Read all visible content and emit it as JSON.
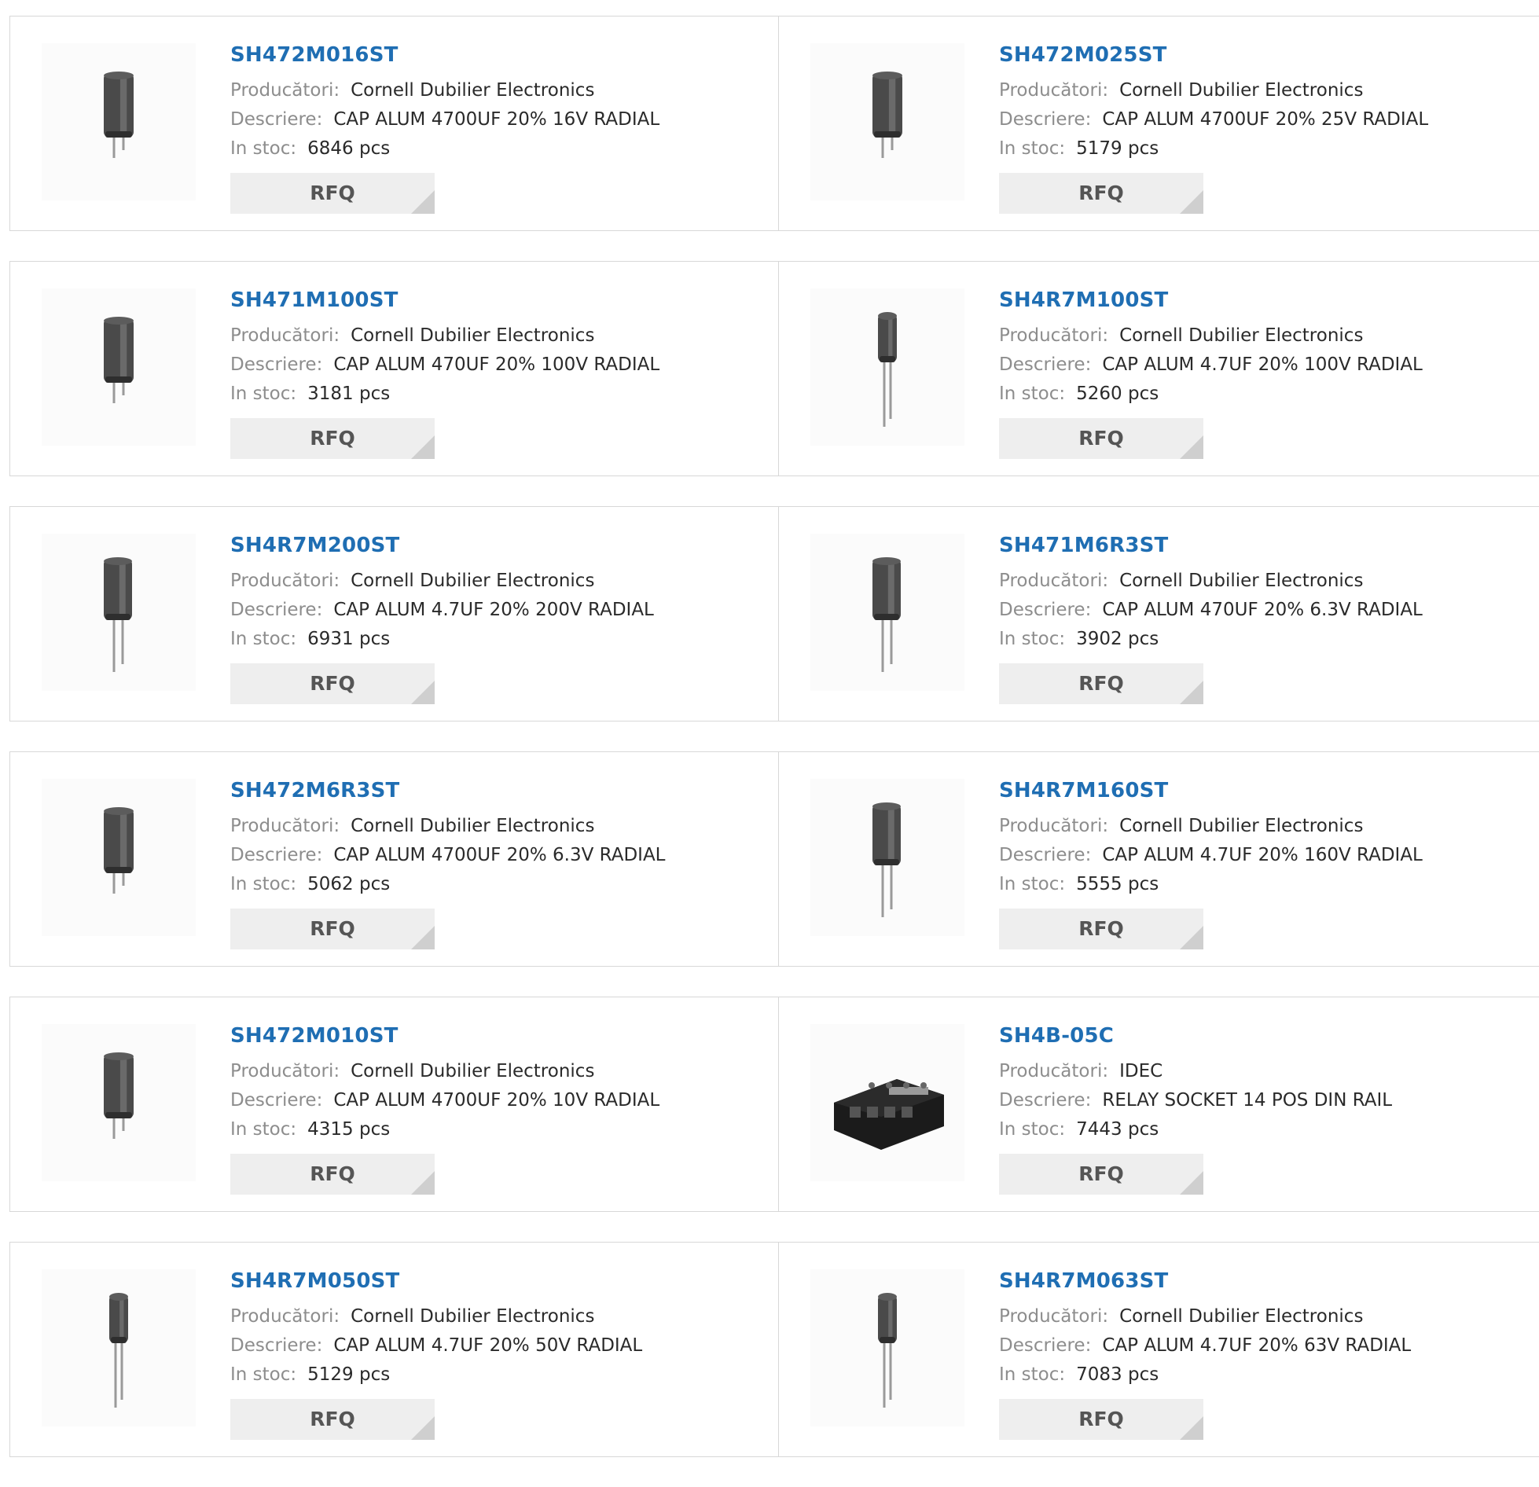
{
  "labels": {
    "manufacturer": "Producători:",
    "description": "Descriere:",
    "stock": "In stoc:",
    "rfq": "RFQ"
  },
  "products": [
    {
      "part": "SH472M016ST",
      "manufacturer": "Cornell Dubilier Electronics",
      "description": "CAP ALUM 4700UF 20% 16V RADIAL",
      "stock": "6846 pcs",
      "image": "capacitor-large-icon"
    },
    {
      "part": "SH472M025ST",
      "manufacturer": "Cornell Dubilier Electronics",
      "description": "CAP ALUM 4700UF 20% 25V RADIAL",
      "stock": "5179 pcs",
      "image": "capacitor-large-icon"
    },
    {
      "part": "SH471M100ST",
      "manufacturer": "Cornell Dubilier Electronics",
      "description": "CAP ALUM 470UF 20% 100V RADIAL",
      "stock": "3181 pcs",
      "image": "capacitor-large-icon"
    },
    {
      "part": "SH4R7M100ST",
      "manufacturer": "Cornell Dubilier Electronics",
      "description": "CAP ALUM 4.7UF 20% 100V RADIAL",
      "stock": "5260 pcs",
      "image": "capacitor-small-icon"
    },
    {
      "part": "SH4R7M200ST",
      "manufacturer": "Cornell Dubilier Electronics",
      "description": "CAP ALUM 4.7UF 20% 200V RADIAL",
      "stock": "6931 pcs",
      "image": "capacitor-medium-icon"
    },
    {
      "part": "SH471M6R3ST",
      "manufacturer": "Cornell Dubilier Electronics",
      "description": "CAP ALUM 470UF 20% 6.3V RADIAL",
      "stock": "3902 pcs",
      "image": "capacitor-medium-icon"
    },
    {
      "part": "SH472M6R3ST",
      "manufacturer": "Cornell Dubilier Electronics",
      "description": "CAP ALUM 4700UF 20% 6.3V RADIAL",
      "stock": "5062 pcs",
      "image": "capacitor-large-icon"
    },
    {
      "part": "SH4R7M160ST",
      "manufacturer": "Cornell Dubilier Electronics",
      "description": "CAP ALUM 4.7UF 20% 160V RADIAL",
      "stock": "5555 pcs",
      "image": "capacitor-medium-icon"
    },
    {
      "part": "SH472M010ST",
      "manufacturer": "Cornell Dubilier Electronics",
      "description": "CAP ALUM 4700UF 20% 10V RADIAL",
      "stock": "4315 pcs",
      "image": "capacitor-large-icon"
    },
    {
      "part": "SH4B-05C",
      "manufacturer": "IDEC",
      "description": "RELAY SOCKET 14 POS DIN RAIL",
      "stock": "7443 pcs",
      "image": "relay-socket-icon"
    },
    {
      "part": "SH4R7M050ST",
      "manufacturer": "Cornell Dubilier Electronics",
      "description": "CAP ALUM 4.7UF 20% 50V RADIAL",
      "stock": "5129 pcs",
      "image": "capacitor-small-icon"
    },
    {
      "part": "SH4R7M063ST",
      "manufacturer": "Cornell Dubilier Electronics",
      "description": "CAP ALUM 4.7UF 20% 63V RADIAL",
      "stock": "7083 pcs",
      "image": "capacitor-small-icon"
    }
  ]
}
